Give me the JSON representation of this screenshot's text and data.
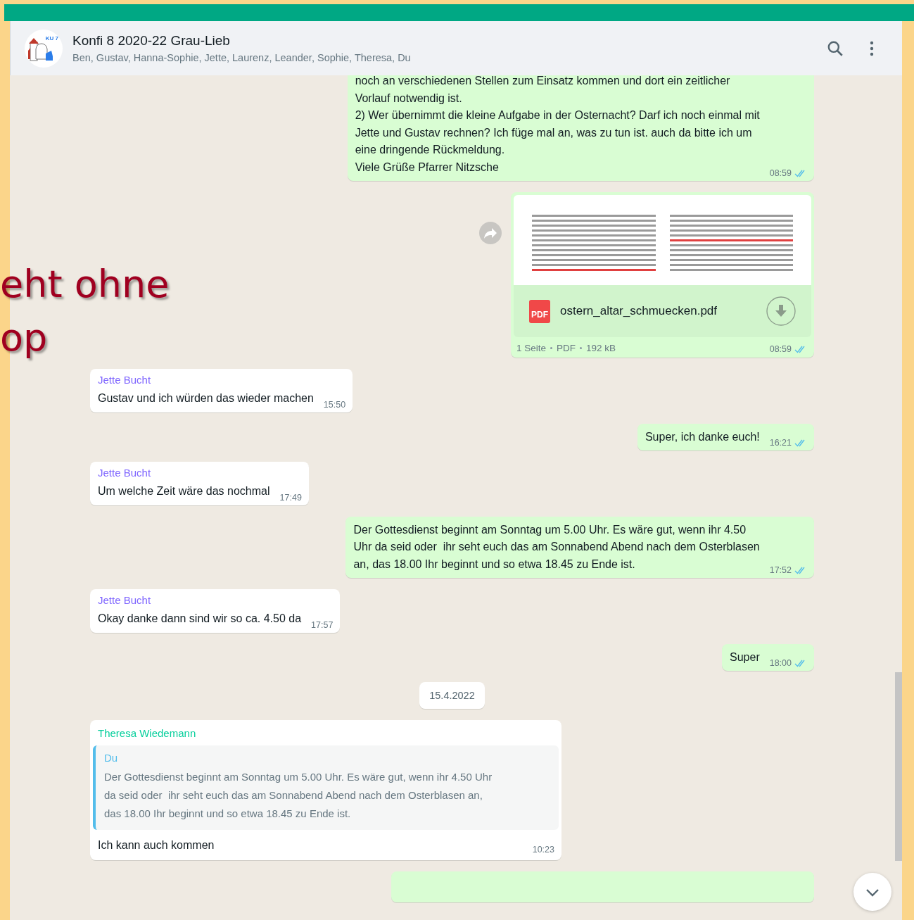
{
  "header": {
    "title": "Konfi 8 2020-22 Grau-Lieb",
    "members": "Ben, Gustav, Hanna-Sophie, Jette, Laurenz, Leander, Sophie, Theresa, Du",
    "avatar_label": "KU 7"
  },
  "background_slide_text": [
    "eht ohne",
    "op"
  ],
  "messages": [
    {
      "kind": "text",
      "outgoing": true,
      "text": "noch an verschiedenen Stellen zum Einsatz kommen und dort ein zeitlicher\nVorlauf notwendig ist.\n2) Wer übernimmt die kleine Aufgabe in der Osternacht? Darf ich noch einmal mit\nJette und Gustav rechnen? Ich füge mal an, was zu tun ist. auch da bitte ich um\neine dringende Rückmeldung.\nViele Grüße Pfarrer Nitzsche",
      "time": "08:59",
      "read": true
    },
    {
      "kind": "document",
      "outgoing": true,
      "file_name": "ostern_altar_schmuecken.pdf",
      "file_badge": "PDF",
      "meta": [
        "1 Seite",
        "PDF",
        "192 kB"
      ],
      "time": "08:59",
      "read": true
    },
    {
      "kind": "text",
      "outgoing": false,
      "sender": "Jette Bucht",
      "color": "#7f66ff",
      "text": "Gustav und ich würden das wieder machen",
      "time": "15:50"
    },
    {
      "kind": "text",
      "outgoing": true,
      "text": "Super, ich danke euch!",
      "time": "16:21",
      "read": true
    },
    {
      "kind": "text",
      "outgoing": false,
      "sender": "Jette Bucht",
      "color": "#7f66ff",
      "text": "Um welche Zeit wäre das nochmal",
      "time": "17:49"
    },
    {
      "kind": "text",
      "outgoing": true,
      "text": "Der Gottesdienst beginnt am Sonntag um 5.00 Uhr. Es wäre gut, wenn ihr 4.50\nUhr da seid oder  ihr seht euch das am Sonnabend Abend nach dem Osterblasen\nan, das 18.00 Ihr beginnt und so etwa 18.45 zu Ende ist.",
      "time": "17:52",
      "read": true
    },
    {
      "kind": "text",
      "outgoing": false,
      "sender": "Jette Bucht",
      "color": "#7f66ff",
      "text": "Okay danke dann sind wir so ca. 4.50 da",
      "time": "17:57"
    },
    {
      "kind": "text",
      "outgoing": true,
      "text": "Super",
      "time": "18:00",
      "read": true
    },
    {
      "kind": "date",
      "text": "15.4.2022"
    },
    {
      "kind": "quote",
      "outgoing": false,
      "sender": "Theresa Wiedemann",
      "color": "#06cf9c",
      "quoted_sender": "Du",
      "quoted_text": "Der Gottesdienst beginnt am Sonntag um 5.00 Uhr. Es wäre gut, wenn ihr 4.50 Uhr\nda seid oder  ihr seht euch das am Sonnabend Abend nach dem Osterblasen an,\ndas 18.00 Ihr beginnt und so etwa 18.45 zu Ende ist.",
      "text": "Ich kann auch kommen",
      "time": "10:23"
    },
    {
      "kind": "cut_off",
      "outgoing": true
    }
  ]
}
